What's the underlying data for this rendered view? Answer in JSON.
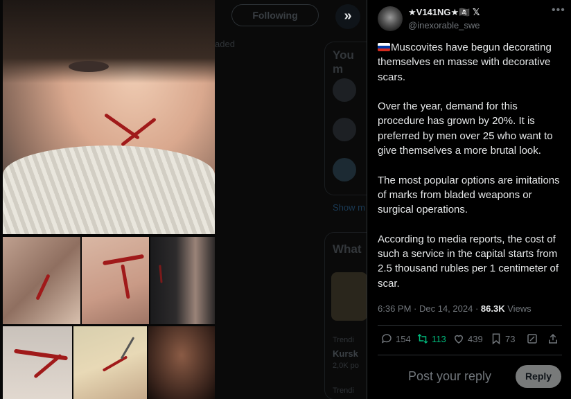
{
  "background_timeline": {
    "following_tab": "Following",
    "snippet_top": "aded",
    "sidebar_heading_1": "You m",
    "show_more": "Show m",
    "sidebar_heading_2": "What",
    "trend_category_1": "Trendi",
    "trend_title_1": "Kursk",
    "trend_posts_1": "2,0K po",
    "trend_category_2": "Trendi"
  },
  "media": {
    "expand_icon": "double-chevron-right-icon"
  },
  "tweet": {
    "author_name": "★V141NG★🏴‍☠️ 𝕏",
    "author_handle": "@inexorable_swe",
    "paragraphs": [
      "Muscovites have begun decorating themselves en masse with decorative scars.",
      "Over the year, demand for this procedure has grown by 20%. It is preferred by men over 25 who want to give themselves a more brutal look.",
      "The most popular options are imitations of marks from bladed weapons or surgical operations.",
      "According to media reports, the cost of such a service in the capital starts from 2.5 thousand rubles per 1 centimeter of scar."
    ],
    "time": "6:36 PM",
    "date": "Dec 14, 2024",
    "views_count": "86.3K",
    "views_label": "Views"
  },
  "actions": {
    "replies": "154",
    "reposts": "113",
    "likes": "439",
    "bookmarks": "73"
  },
  "reply": {
    "placeholder": "Post your reply",
    "button": "Reply"
  },
  "colors": {
    "repost_active": "#00ba7c",
    "muted": "#71767b",
    "text": "#e7e9ea"
  }
}
